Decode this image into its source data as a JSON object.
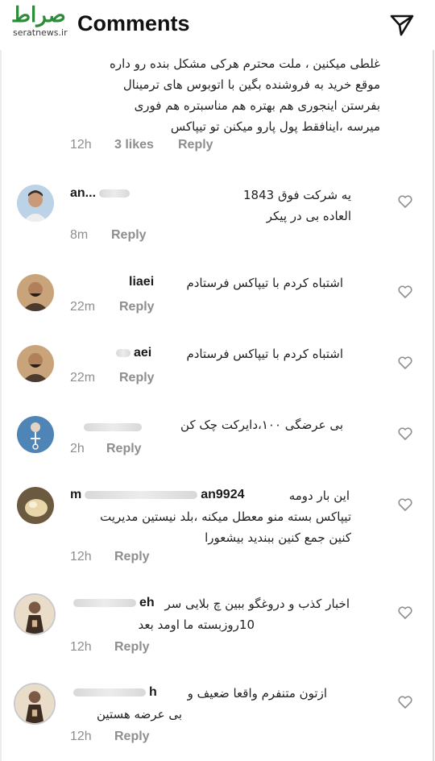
{
  "header": {
    "title": "Comments",
    "send_icon": "send-icon"
  },
  "watermark": {
    "logo_text": "صراط",
    "url": "seratnews.ir"
  },
  "top_comment": {
    "lines": [
      "غلطی میکنین ، ملت محترم هرکی مشکل بنده رو داره",
      "موقع خرید به فروشنده بگین با اتوبوس های ترمینال",
      "بفرستن اینجوری هم بهتره هم مناسبتره هم فوری",
      "میرسه ،اینافقط پول پارو میکنن تو تیپاکس"
    ],
    "time": "12h",
    "likes": "3 likes",
    "reply": "Reply"
  },
  "comments": [
    {
      "user": "an...",
      "user_tail": "",
      "text_lines": [
        "یه شرکت فوق 1843",
        "العاده بی در پیکر"
      ],
      "time": "8m",
      "reply": "Reply"
    },
    {
      "user": "",
      "user_tail": "liaei",
      "text_lines": [
        "اشتباه کردم با تیپاکس فرستادم"
      ],
      "time": "22m",
      "reply": "Reply"
    },
    {
      "user": "",
      "user_tail": "aei",
      "text_lines": [
        "اشتباه کردم با تیپاکس فرستادم"
      ],
      "time": "22m",
      "reply": "Reply"
    },
    {
      "user": "",
      "user_tail": "",
      "text_lines": [
        "بی عرضگی ۱۰۰،دایرکت چک کن"
      ],
      "time": "2h",
      "reply": "Reply"
    },
    {
      "user": "m",
      "user_tail": "an9924",
      "text_lines": [
        "این بار دومه",
        "تیپاکس بسته منو معطل میکنه ،بلد نیستین مدیریت",
        "کنین جمع کنین ببندید بیشعورا"
      ],
      "time": "12h",
      "reply": "Reply"
    },
    {
      "user": "",
      "user_tail": "eh",
      "text_lines": [
        "اخبار کذب و دروغگو ببین چ بلایی سر",
        "10روزبسته ما اومد بعد"
      ],
      "time": "12h",
      "reply": "Reply"
    },
    {
      "user": "",
      "user_tail": "h",
      "text_lines": [
        "ازتون متنفرم واقعا ضعیف و",
        "بی عرضه هستین"
      ],
      "time": "12h",
      "reply": "Reply"
    }
  ],
  "colors": {
    "meta": "#8e8e8e",
    "text": "#262626",
    "watermark": "#2e8b3a"
  }
}
